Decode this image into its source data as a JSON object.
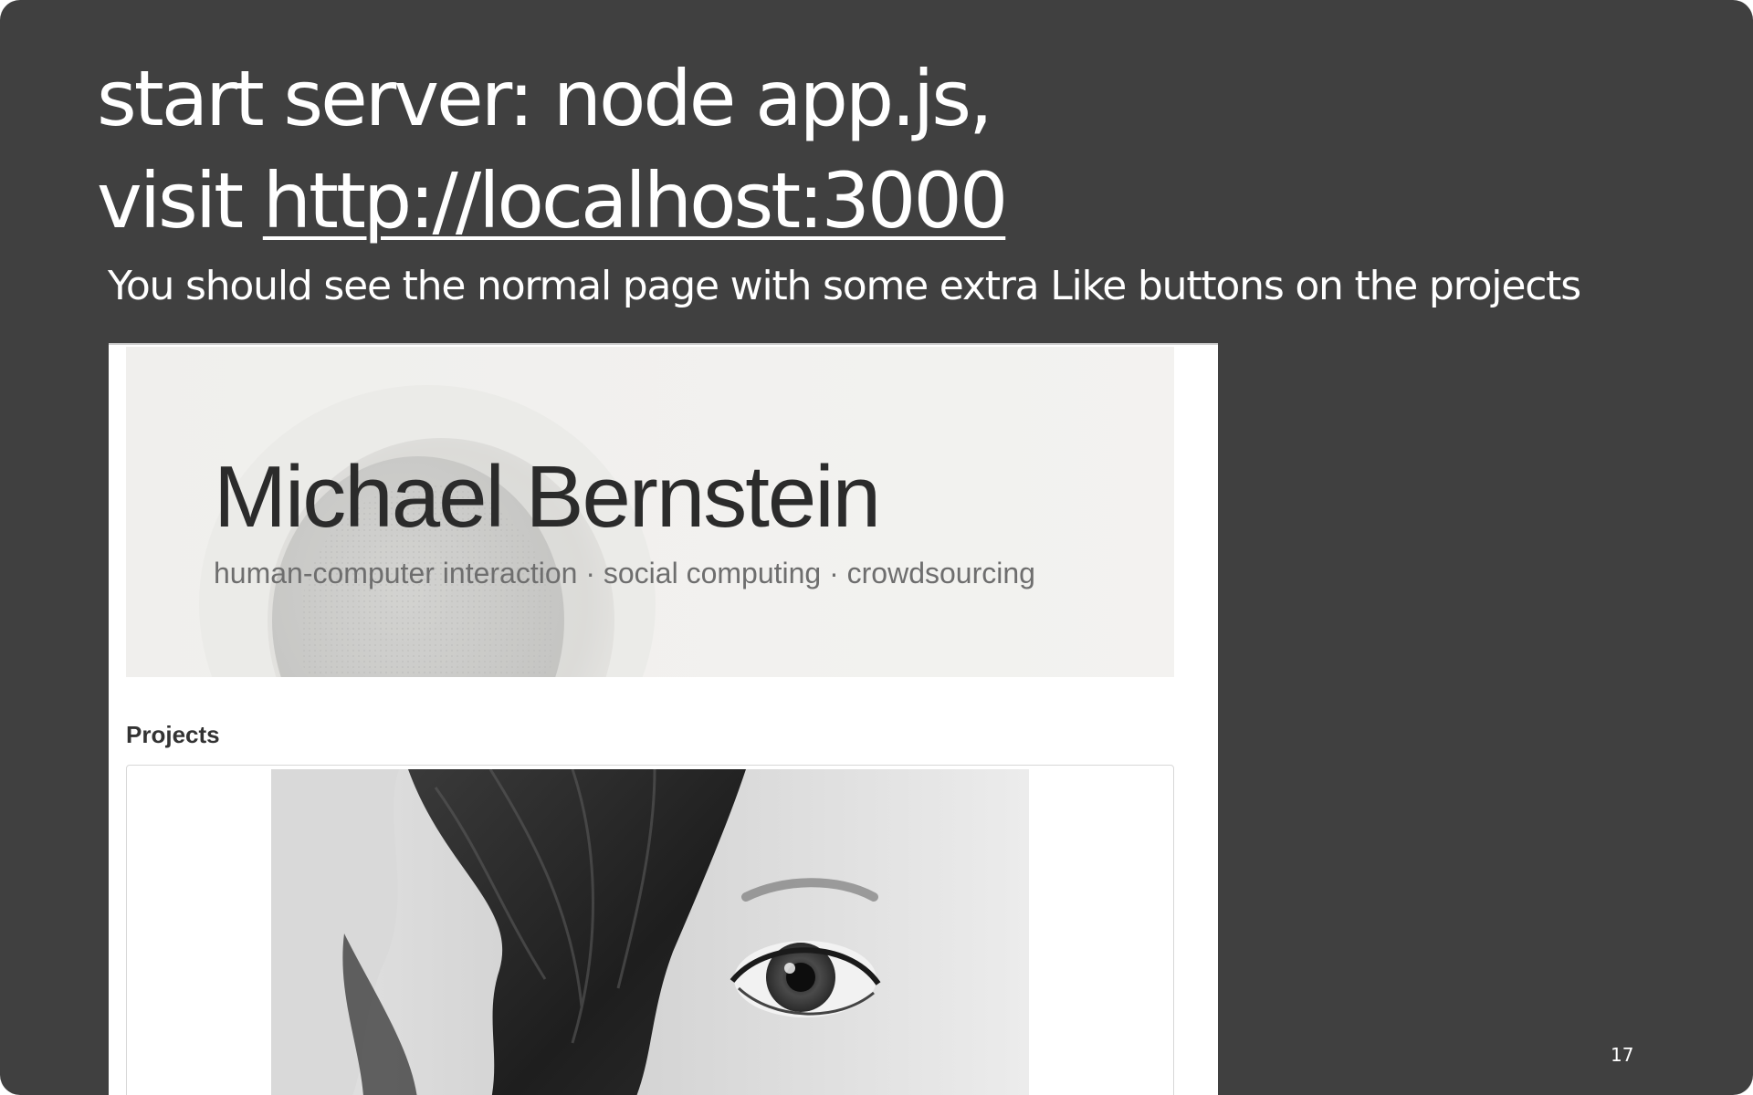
{
  "slide": {
    "title_line1": "start server: node app.js,",
    "title_line2_prefix": "visit ",
    "title_link": "http://localhost:3000",
    "subtitle": "You should see the normal page with some extra Like buttons on the projects",
    "slide_number": "17"
  },
  "screenshot": {
    "site_name": "Michael Bernstein",
    "site_tagline": "human-computer interaction · social computing · crowdsourcing",
    "projects_heading": "Projects",
    "hero_image": "microphone-photo",
    "project_image": "face-photo-with-hair"
  },
  "colors": {
    "slide_background": "#404040",
    "slide_text": "#ffffff",
    "site_name": "#2b2b2b",
    "site_tagline": "#6e6e6e",
    "hero_background": "#f1f0ee"
  }
}
